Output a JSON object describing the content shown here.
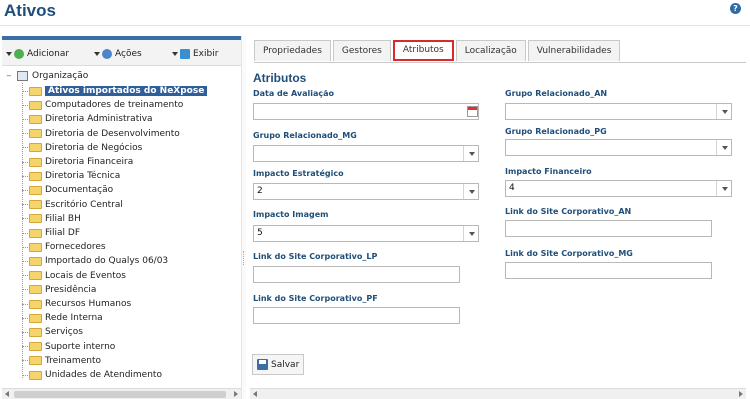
{
  "page": {
    "title": "Ativos",
    "help_icon": "help-icon"
  },
  "toolbar": {
    "add": "Adicionar",
    "actions": "Ações",
    "view": "Exibir"
  },
  "tree": {
    "root": "Organização",
    "items": [
      "Ativos importados do NeXpose",
      "Computadores de treinamento",
      "Diretoria Administrativa",
      "Diretoria de Desenvolvimento",
      "Diretoria de Negócios",
      "Diretoria Financeira",
      "Diretoria Técnica",
      "Documentação",
      "Escritório Central",
      "Filial BH",
      "Filial DF",
      "Fornecedores",
      "Importado do Qualys 06/03",
      "Locais de Eventos",
      "Presidência",
      "Recursos Humanos",
      "Rede Interna",
      "Serviços",
      "Suporte interno",
      "Treinamento",
      "Unidades de Atendimento"
    ],
    "selected_index": 0
  },
  "tabs": [
    "Propriedades",
    "Gestores",
    "Atributos",
    "Localização",
    "Vulnerabilidades"
  ],
  "active_tab": "Atributos",
  "section": {
    "title": "Atributos"
  },
  "fields": {
    "data_avaliacao": {
      "label": "Data de Avaliação",
      "value": ""
    },
    "grupo_mg": {
      "label": "Grupo Relacionado_MG",
      "value": ""
    },
    "impacto_estrategico": {
      "label": "Impacto Estratégico",
      "value": "2"
    },
    "impacto_imagem": {
      "label": "Impacto Imagem",
      "value": "5"
    },
    "link_lp": {
      "label": "Link do Site Corporativo_LP",
      "value": ""
    },
    "link_pf": {
      "label": "Link do Site Corporativo_PF",
      "value": ""
    },
    "grupo_an": {
      "label": "Grupo Relacionado_AN",
      "value": ""
    },
    "grupo_pg": {
      "label": "Grupo Relacionado_PG",
      "value": ""
    },
    "impacto_financeiro": {
      "label": "Impacto Financeiro",
      "value": "4"
    },
    "link_an": {
      "label": "Link do Site Corporativo_AN",
      "value": ""
    },
    "link_mg": {
      "label": "Link do Site Corporativo_MG",
      "value": ""
    }
  },
  "actions": {
    "save": "Salvar"
  },
  "colors": {
    "accent": "#1f4e79",
    "selected": "#2f5f9a",
    "active_tab_border": "#d62b2b",
    "folder": "#f4d46b"
  }
}
